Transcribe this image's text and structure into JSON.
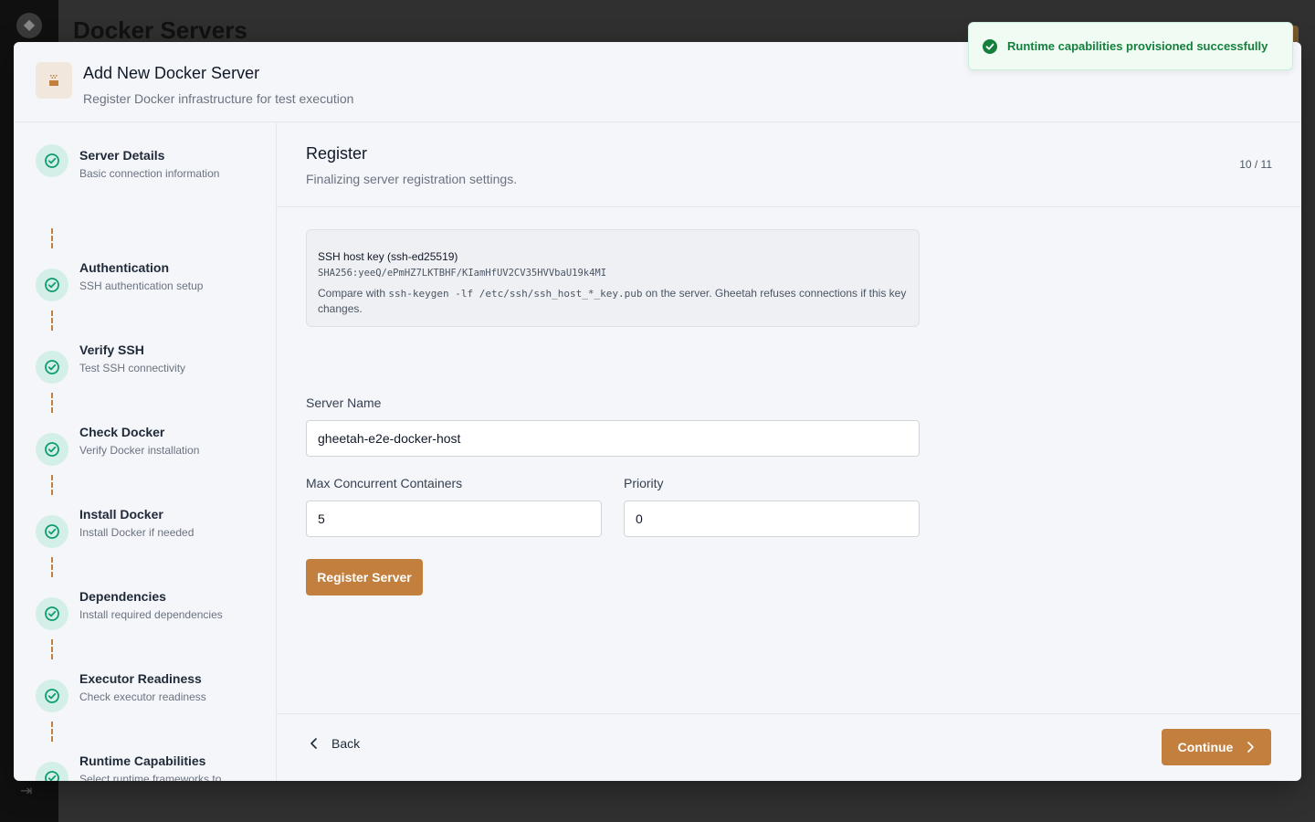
{
  "background": {
    "page_title": "Docker Servers"
  },
  "modal": {
    "title": "Add New Docker Server",
    "subtitle": "Register Docker infrastructure for test execution"
  },
  "steps": [
    {
      "title": "Server Details",
      "desc": "Basic connection information"
    },
    {
      "title": "Authentication",
      "desc": "SSH authentication setup"
    },
    {
      "title": "Verify SSH",
      "desc": "Test SSH connectivity"
    },
    {
      "title": "Check Docker",
      "desc": "Verify Docker installation"
    },
    {
      "title": "Install Docker",
      "desc": "Install Docker if needed"
    },
    {
      "title": "Dependencies",
      "desc": "Install required dependencies"
    },
    {
      "title": "Executor Readiness",
      "desc": "Check executor readiness"
    },
    {
      "title": "Runtime Capabilities",
      "desc": "Select runtime frameworks to provision"
    }
  ],
  "content": {
    "title": "Register",
    "subtitle": "Finalizing server registration settings.",
    "step_counter": "10 / 11"
  },
  "hostkey": {
    "title": "SSH host key (ssh-ed25519)",
    "fingerprint": "SHA256:yeeQ/ePmHZ7LKTBHF/KIamHfUV2CV35HVVbaU19k4MI",
    "note_pre": "Compare with ",
    "note_cmd": "ssh-keygen -lf /etc/ssh/ssh_host_*_key.pub",
    "note_post": " on the server. Gheetah refuses connections if this key changes."
  },
  "form": {
    "server_name_label": "Server Name",
    "server_name_value": "gheetah-e2e-docker-host",
    "max_containers_label": "Max Concurrent Containers",
    "max_containers_value": "5",
    "priority_label": "Priority",
    "priority_value": "0",
    "register_label": "Register Server"
  },
  "footer": {
    "back_label": "Back",
    "continue_label": "Continue"
  },
  "toast": {
    "message": "Runtime capabilities provisioned successfully"
  },
  "colors": {
    "accent": "#c27f3d",
    "step_done_bg": "#d4efe8",
    "step_done_icon": "#0f9d6e",
    "toast_text": "#15803d"
  }
}
